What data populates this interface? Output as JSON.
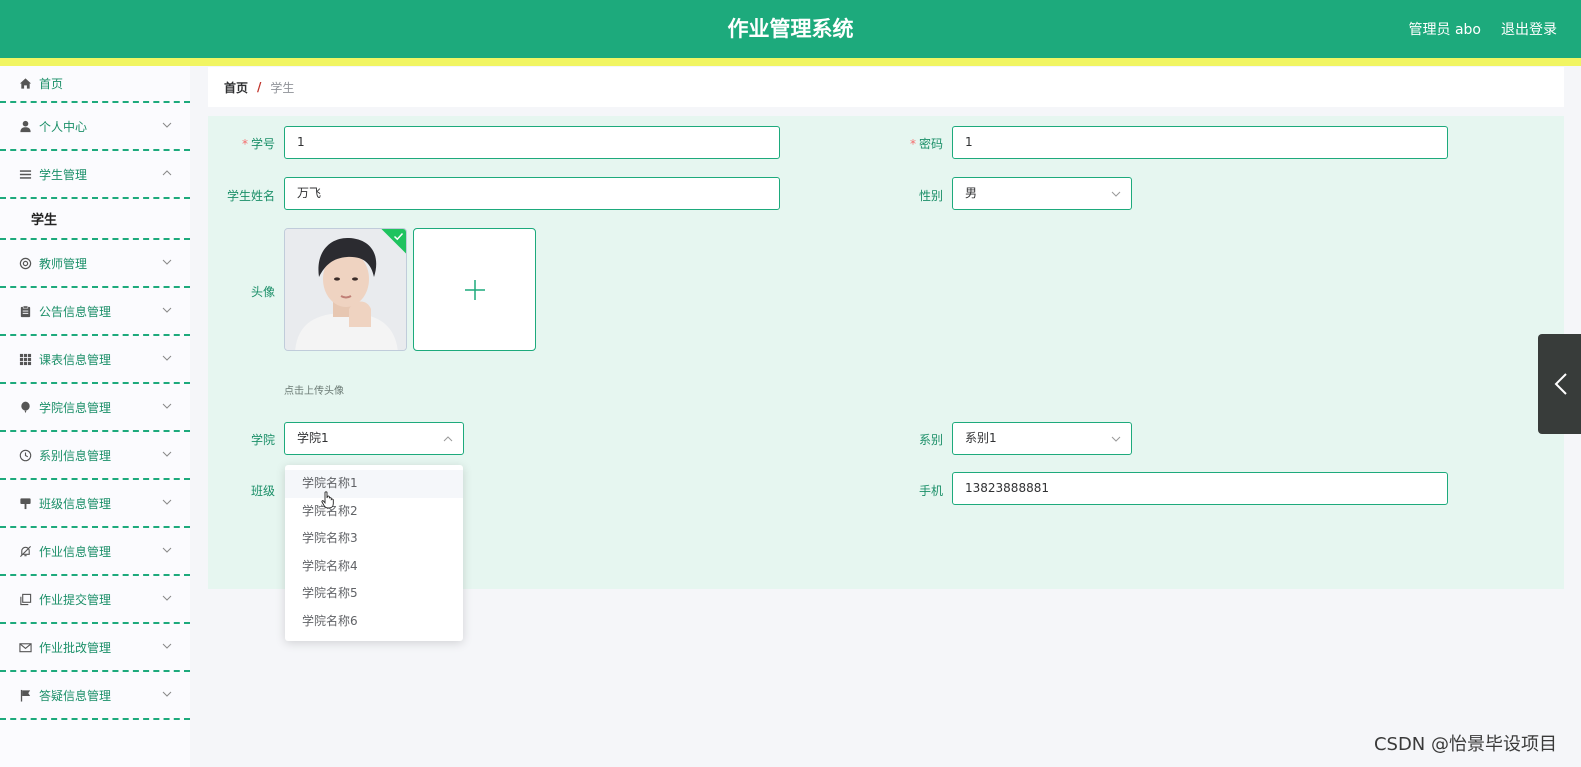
{
  "header": {
    "title": "作业管理系统",
    "user_label": "管理员 abo",
    "logout_label": "退出登录"
  },
  "sidebar": {
    "items": [
      {
        "label": "首页",
        "icon": "home-icon"
      },
      {
        "label": "个人中心",
        "icon": "user-icon"
      },
      {
        "label": "学生管理",
        "icon": "list-icon",
        "expanded": true,
        "children": [
          {
            "label": "学生"
          }
        ]
      },
      {
        "label": "教师管理",
        "icon": "at-icon"
      },
      {
        "label": "公告信息管理",
        "icon": "clipboard-icon"
      },
      {
        "label": "课表信息管理",
        "icon": "grid-icon"
      },
      {
        "label": "学院信息管理",
        "icon": "balloon-icon"
      },
      {
        "label": "系别信息管理",
        "icon": "clock-icon"
      },
      {
        "label": "班级信息管理",
        "icon": "brush-icon"
      },
      {
        "label": "作业信息管理",
        "icon": "bell-off-icon"
      },
      {
        "label": "作业提交管理",
        "icon": "copy-icon"
      },
      {
        "label": "作业批改管理",
        "icon": "mail-icon"
      },
      {
        "label": "答疑信息管理",
        "icon": "flag-icon"
      }
    ]
  },
  "breadcrumb": {
    "home": "首页",
    "separator": "/",
    "current": "学生"
  },
  "form": {
    "student_id": {
      "label": "学号",
      "value": "1",
      "required": true
    },
    "password": {
      "label": "密码",
      "value": "1",
      "required": true
    },
    "name": {
      "label": "学生姓名",
      "value": "万飞"
    },
    "gender": {
      "label": "性别",
      "value": "男"
    },
    "avatar": {
      "label": "头像",
      "tip": "点击上传头像"
    },
    "college": {
      "label": "学院",
      "value": "学院1"
    },
    "department": {
      "label": "系别",
      "value": "系别1"
    },
    "class": {
      "label": "班级"
    },
    "phone": {
      "label": "手机",
      "value": "13823888881"
    }
  },
  "college_dropdown": {
    "options": [
      "学院名称1",
      "学院名称2",
      "学院名称3",
      "学院名称4",
      "学院名称5",
      "学院名称6"
    ],
    "hovered_index": 0
  },
  "watermark": "CSDN @怡景毕设项目",
  "colors": {
    "primary": "#1daa7c",
    "stripe": "#f1f562",
    "panel": "#e6f6f0",
    "required": "#f56c6c"
  }
}
